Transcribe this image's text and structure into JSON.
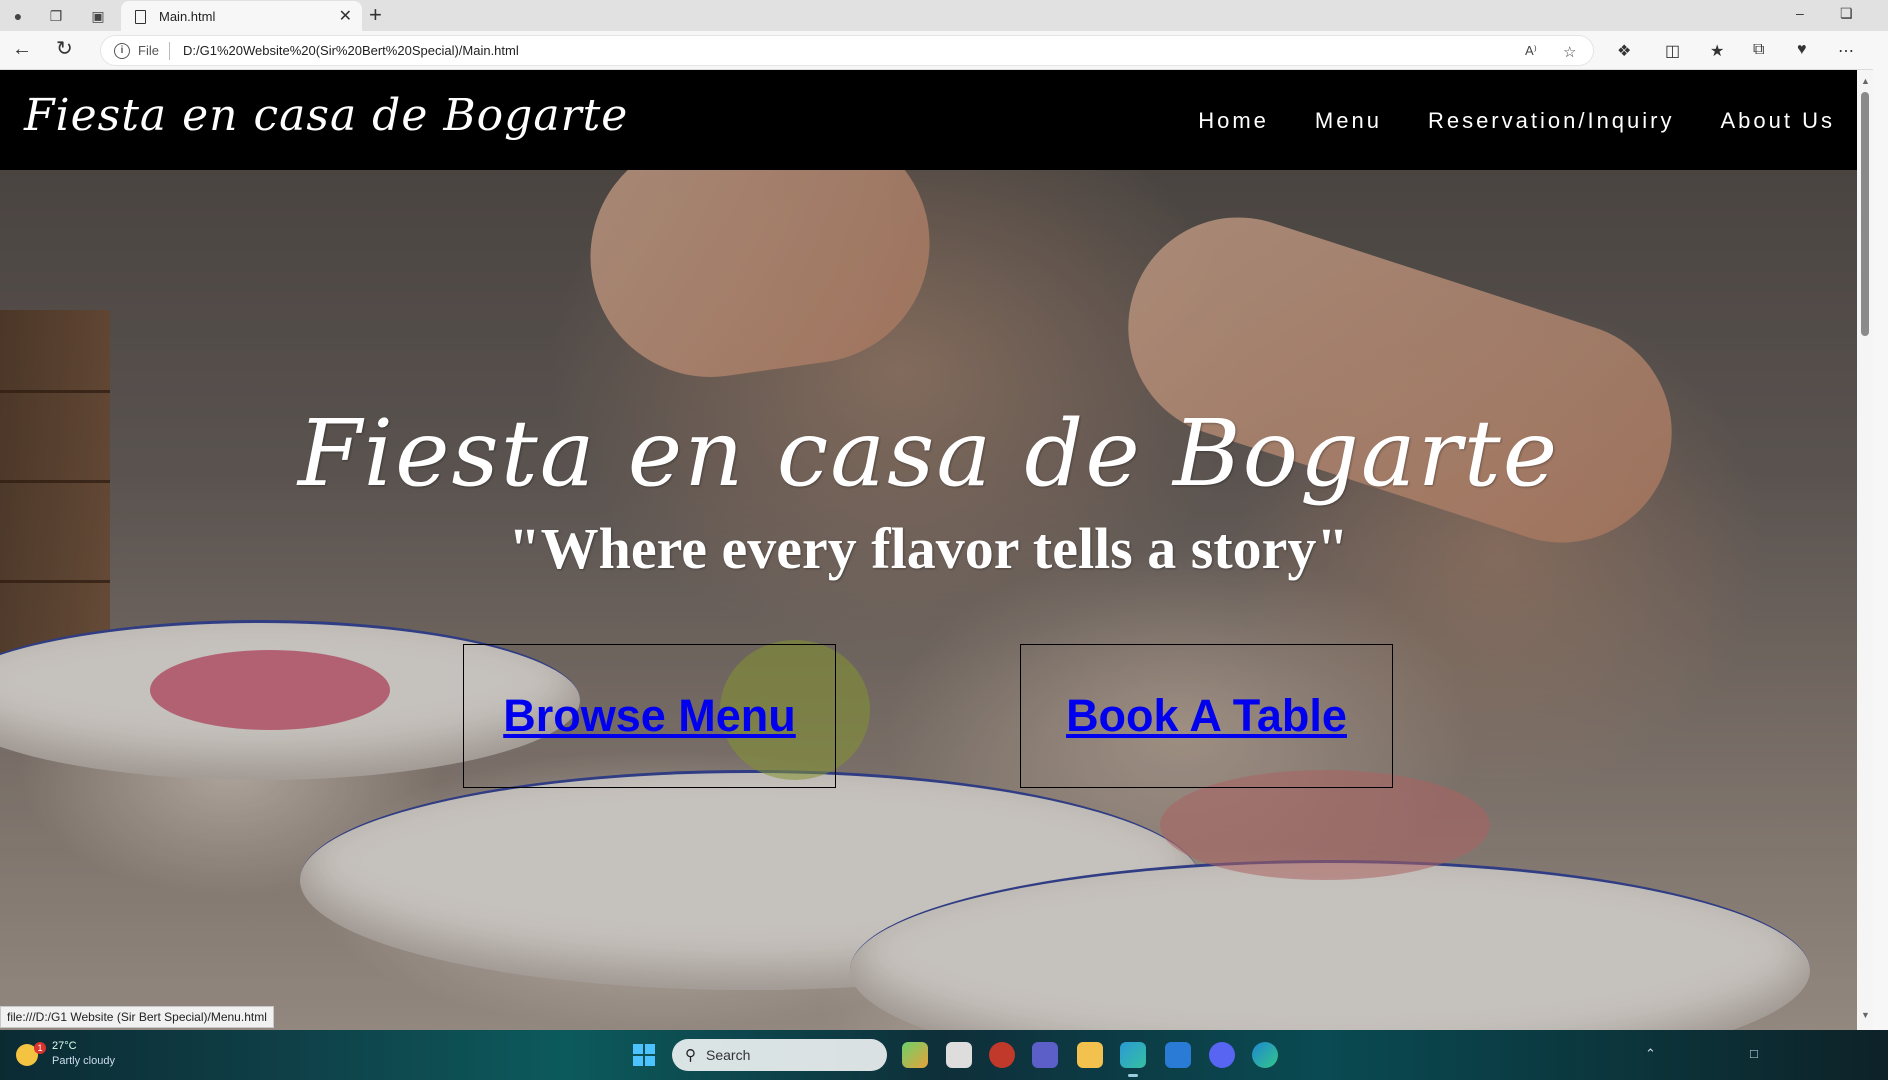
{
  "browser": {
    "tab_title": "Main.html",
    "new_tab": "+",
    "address_scheme": "File",
    "address_url": "D:/G1%20Website%20(Sir%20Bert%20Special)/Main.html",
    "status_url": "file:///D:/G1 Website (Sir Bert Special)/Menu.html",
    "read_aloud_icon": "A⁾"
  },
  "site": {
    "logo": "Fiesta en casa de Bogarte",
    "nav": [
      "Home",
      "Menu",
      "Reservation/Inquiry",
      "About Us"
    ],
    "hero_title": "Fiesta en casa de Bogarte",
    "hero_tagline": "\"Where every flavor tells a story\"",
    "cta_browse": "Browse Menu",
    "cta_book": "Book A Table",
    "link_color": "#0000ee"
  },
  "taskbar": {
    "search_label": "Search",
    "weather_temp": "27°C",
    "weather_condition": "Partly cloudy",
    "weather_badge": "1"
  }
}
